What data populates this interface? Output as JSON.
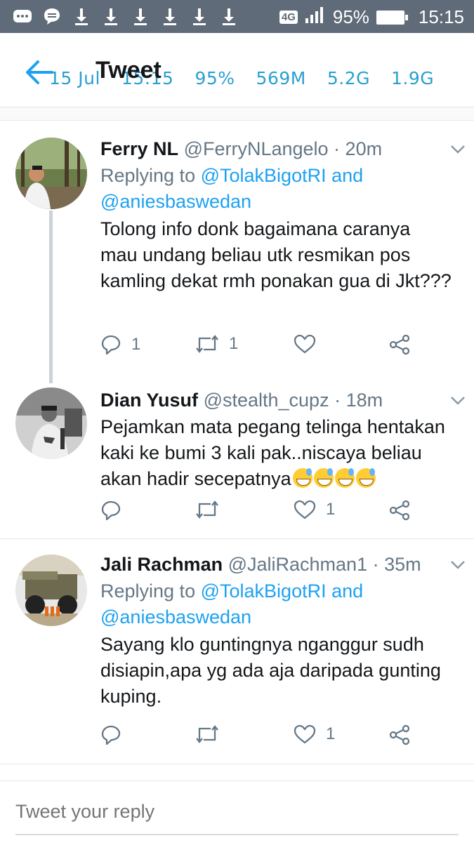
{
  "status_bar": {
    "network": "4G",
    "battery": "95%",
    "time": "15:15",
    "left_icons": [
      "more-icon",
      "message-icon",
      "download-icon",
      "download-icon",
      "download-icon",
      "download-icon",
      "download-icon",
      "download-icon"
    ]
  },
  "info_bar": {
    "date": "15 Jul",
    "time": "15:15",
    "battery": "95%",
    "ram": "569M",
    "storage1": "5.2G",
    "storage2": "1.9G"
  },
  "header": {
    "title": "Tweet"
  },
  "tweets": [
    {
      "name": "Ferry NL",
      "handle": "@FerryNLangelo · 20m",
      "replying_prefix": "Replying to",
      "replying_link1": "@TolakBigotRI and",
      "replying_link2": "@aniesbaswedan",
      "text": "Tolong info donk bagaimana caranya mau undang beliau utk resmikan pos kamling dekat rmh ponakan gua di Jkt???",
      "reply_count": "1",
      "retweet_count": "1",
      "like_count": ""
    },
    {
      "name": "Dian Yusuf",
      "handle": "@stealth_cupz · 18m",
      "text": "Pejamkan mata pegang telinga hentakan kaki ke bumi 3 kali pak..niscaya beliau akan hadir secepatnya",
      "reply_count": "",
      "retweet_count": "",
      "like_count": "1"
    },
    {
      "name": "Jali Rachman",
      "handle": "@JaliRachman1 · 35m",
      "replying_prefix": "Replying to",
      "replying_link1": "@TolakBigotRI and",
      "replying_link2": "@aniesbaswedan",
      "text": "Sayang klo guntingnya nganggur sudh disiapin,apa yg ada aja daripada gunting kuping.",
      "reply_count": "",
      "retweet_count": "",
      "like_count": "1"
    }
  ],
  "composer": {
    "placeholder": "Tweet your reply"
  },
  "colors": {
    "accent": "#1da1f2",
    "text": "#14171a",
    "muted": "#657786",
    "statusbar": "#5f6b78",
    "infobar": "#2a9fd1"
  }
}
